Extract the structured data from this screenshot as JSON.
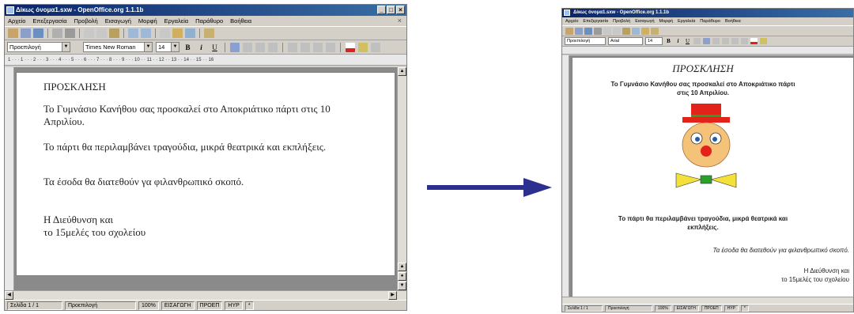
{
  "left_window": {
    "title": "Δίκως όνομα1.sxw - OpenOffice.org 1.1.1b",
    "menu": [
      "Αρχείο",
      "Επεξεργασία",
      "Προβολή",
      "Εισαγωγή",
      "Μορφή",
      "Εργαλεία",
      "Παράθυρο",
      "Βοήθεια"
    ],
    "style_value": "Προεπιλογή",
    "font_value": "Times New Roman",
    "size_value": "14",
    "ruler_text": "1 · · · 1 · · · 2 · · · 3 · · · 4 · · · 5 · · · 6 · · · 7 · · · 8 · · · 9 · · · 10 · · 11 · · 12 · · 13 · · 14 · · 15 · · 16",
    "doc": {
      "heading": "ΠΡΟΣΚΛΗΣΗ",
      "line1": "Το Γυμνάσιο Κανήθου σας προσκαλεί στο Αποκριάτικο πάρτι στις 10",
      "line1b": "Απριλίου.",
      "line2": "Το πάρτι θα περιλαμβάνει τραγούδια, μικρά θεατρικά και εκπλήξεις.",
      "line3": "Τα έσοδα θα διατεθούν γα φιλανθρωπικό σκοπό.",
      "sign1": "Η Διεύθυνση και",
      "sign2": "το 15μελές του σχολείου"
    },
    "status": [
      "Σελίδα 1 / 1",
      "Προεπιλογή",
      "100%",
      "ΕΙΣΑΓΩΓΗ",
      "ΠΡΟΕΠ",
      "HYP",
      "*"
    ]
  },
  "right_window": {
    "title": "Δίκως όνομα1.sxw - OpenOffice.org 1.1.1b",
    "menu": [
      "Αρχείο",
      "Επεξεργασία",
      "Προβολή",
      "Εισαγωγή",
      "Μορφή",
      "Εργαλεία",
      "Παράθυρο",
      "Βοήθεια"
    ],
    "style_value": "Προεπιλογή",
    "font_value": "Arial",
    "size_value": "14",
    "doc": {
      "heading": "ΠΡΟΣΚΛΗΣΗ",
      "line1a": "Το Γυμνάσιο Κανήθου σας προσκαλεί στο Αποκριάτικο πάρτι",
      "line1b": "στις 10 Απριλίου.",
      "line2a": "Το πάρτι θα περιλαμβάνει τραγούδια, μικρά θεατρικά και",
      "line2b": "εκπλήξεις.",
      "line3": "Τα έσοδα θα διατεθούν για φιλανθρωπικό σκοπό.",
      "sign1": "Η Διεύθυνση και",
      "sign2": "το 15μελές του σχολείου"
    },
    "status": [
      "Σελίδα 1 / 1",
      "Προεπιλογή",
      "100%",
      "ΕΙΣΑΓΩΓΗ",
      "ΠΡΟΕΠ",
      "HYP",
      "*"
    ]
  },
  "colors": {
    "arrow": "#2b2f8f",
    "titlebar": "#0a246a",
    "clown_hat": "#e32219",
    "clown_face": "#f5c27a",
    "clown_nose": "#e32219",
    "bowtie": "#f3e13a",
    "hat_band": "#2aa02a"
  }
}
